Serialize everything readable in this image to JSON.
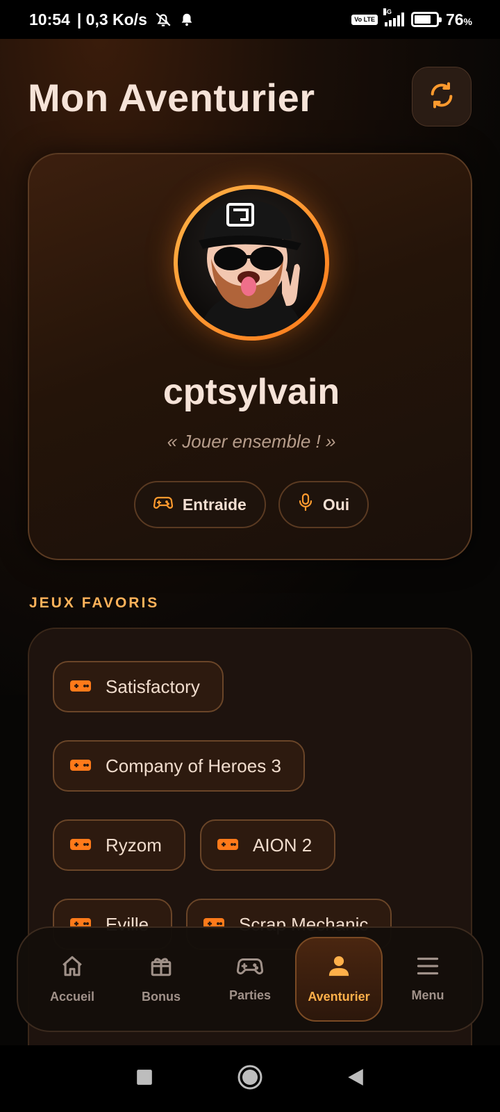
{
  "status_bar": {
    "time": "10:54",
    "speed": "| 0,3 Ko/s",
    "volte_label": "Vo LTE",
    "network": "4G",
    "battery_percent": "76",
    "battery_unit": "%",
    "battery_level": 0.76
  },
  "header": {
    "title": "Mon Aventurier",
    "refresh_icon": "refresh-icon"
  },
  "profile": {
    "username": "cptsylvain",
    "tagline": "« Jouer ensemble ! »",
    "chips": [
      {
        "label": "Entraide",
        "icon": "gamepad-icon"
      },
      {
        "label": "Oui",
        "icon": "microphone-icon"
      }
    ]
  },
  "favorites": {
    "section_label": "JEUX FAVORIS",
    "games": [
      "Satisfactory",
      "Company of Heroes 3",
      "Ryzom",
      "AION 2",
      "Eville",
      "Scrap Mechanic"
    ]
  },
  "bottom_nav": {
    "items": [
      {
        "label": "Accueil",
        "icon": "home-icon",
        "active": false
      },
      {
        "label": "Bonus",
        "icon": "gift-icon",
        "active": false
      },
      {
        "label": "Parties",
        "icon": "gamepad-icon",
        "active": false
      },
      {
        "label": "Aventurier",
        "icon": "user-icon",
        "active": true
      },
      {
        "label": "Menu",
        "icon": "menu-icon",
        "active": false
      }
    ]
  },
  "colors": {
    "accent": "#ffb04a",
    "orange": "#ff7a1a",
    "background": "#070605",
    "text": "#f6e3d8"
  }
}
